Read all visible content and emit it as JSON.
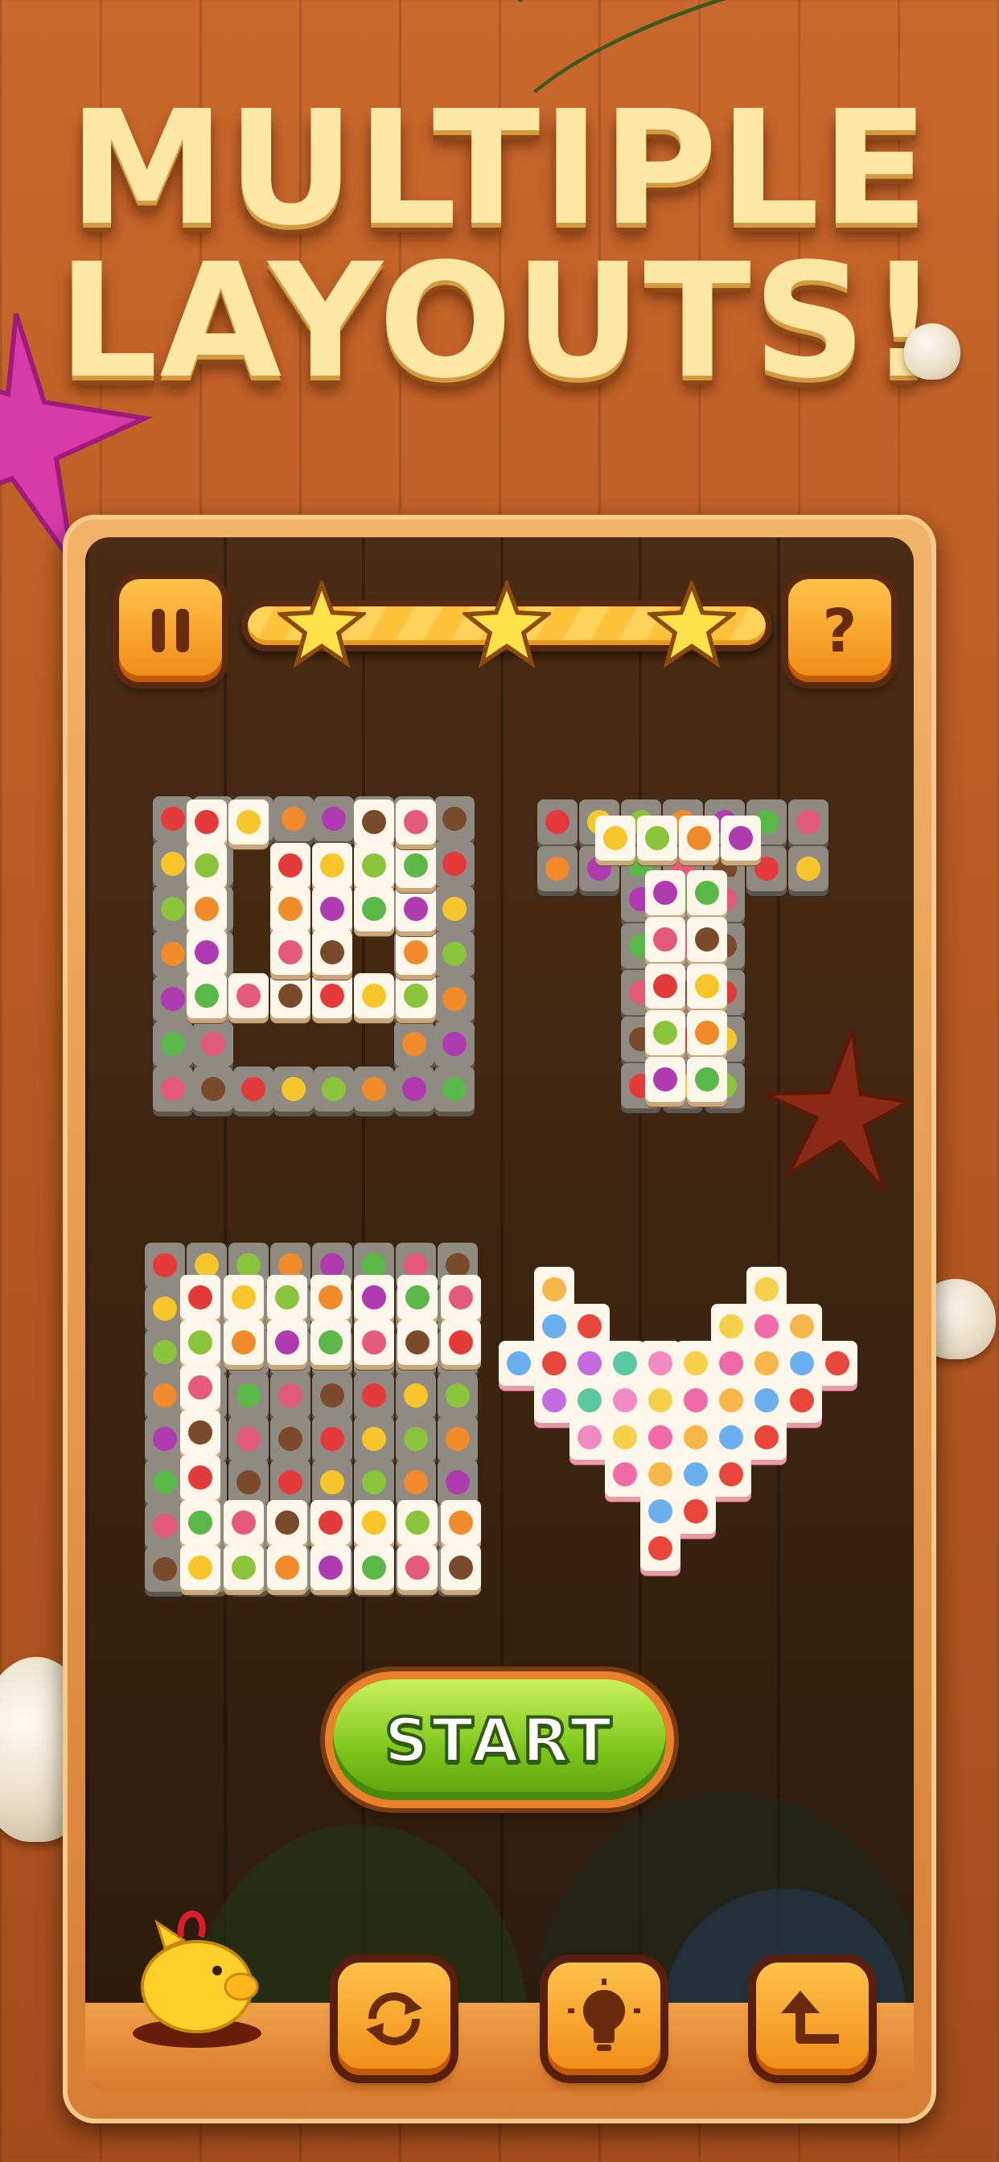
{
  "headline": {
    "line1": "MULTIPLE",
    "line2": "LAYOUTS!"
  },
  "top_bar": {
    "pause_icon": "pause-icon",
    "help_icon": "question-mark-icon",
    "stars_earned": 3,
    "stars_total": 3,
    "progress": 1.0
  },
  "layouts": [
    "fruit-tiles-spiral",
    "fruit-tiles-t-shape",
    "fruit-tiles-c-shape",
    "dessert-tiles-heart"
  ],
  "start_button": {
    "label": "START"
  },
  "tools": [
    {
      "name": "piggy-bank-icon"
    },
    {
      "name": "shuffle-icon"
    },
    {
      "name": "hint-lightbulb-icon"
    },
    {
      "name": "undo-icon"
    }
  ],
  "colors": {
    "accent": "#f08a14",
    "button_green": "#7cc41a",
    "board": "#3c2410",
    "headline": "#fde7a5"
  }
}
